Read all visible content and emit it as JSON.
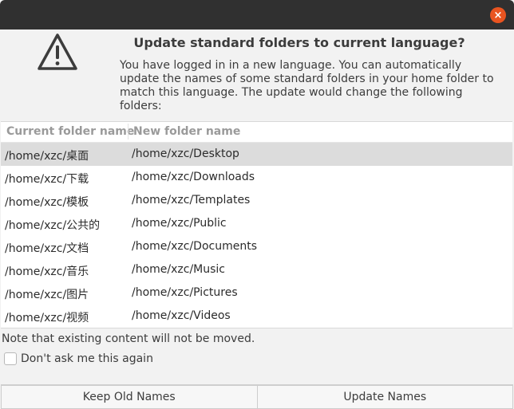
{
  "dialog": {
    "title": "Update standard folders to current language?",
    "message": "You have logged in in a new language. You can automatically update the names of some standard folders in your home folder to match this language. The update would change the following folders:",
    "close_glyph": "×",
    "warning_icon": "warning-triangle-icon",
    "accent_color": "#e95420"
  },
  "table": {
    "columns": [
      "Current folder name",
      "New folder name"
    ],
    "rows": [
      {
        "current": "/home/xzc/桌面",
        "new": "/home/xzc/Desktop"
      },
      {
        "current": "/home/xzc/下载",
        "new": "/home/xzc/Downloads"
      },
      {
        "current": "/home/xzc/模板",
        "new": "/home/xzc/Templates"
      },
      {
        "current": "/home/xzc/公共的",
        "new": "/home/xzc/Public"
      },
      {
        "current": "/home/xzc/文档",
        "new": "/home/xzc/Documents"
      },
      {
        "current": "/home/xzc/音乐",
        "new": "/home/xzc/Music"
      },
      {
        "current": "/home/xzc/图片",
        "new": "/home/xzc/Pictures"
      },
      {
        "current": "/home/xzc/视频",
        "new": "/home/xzc/Videos"
      }
    ]
  },
  "note": "Note that existing content will not be moved.",
  "dont_ask": {
    "label": "Don't ask me this again",
    "checked": false
  },
  "buttons": {
    "keep": "Keep Old Names",
    "update": "Update Names"
  }
}
